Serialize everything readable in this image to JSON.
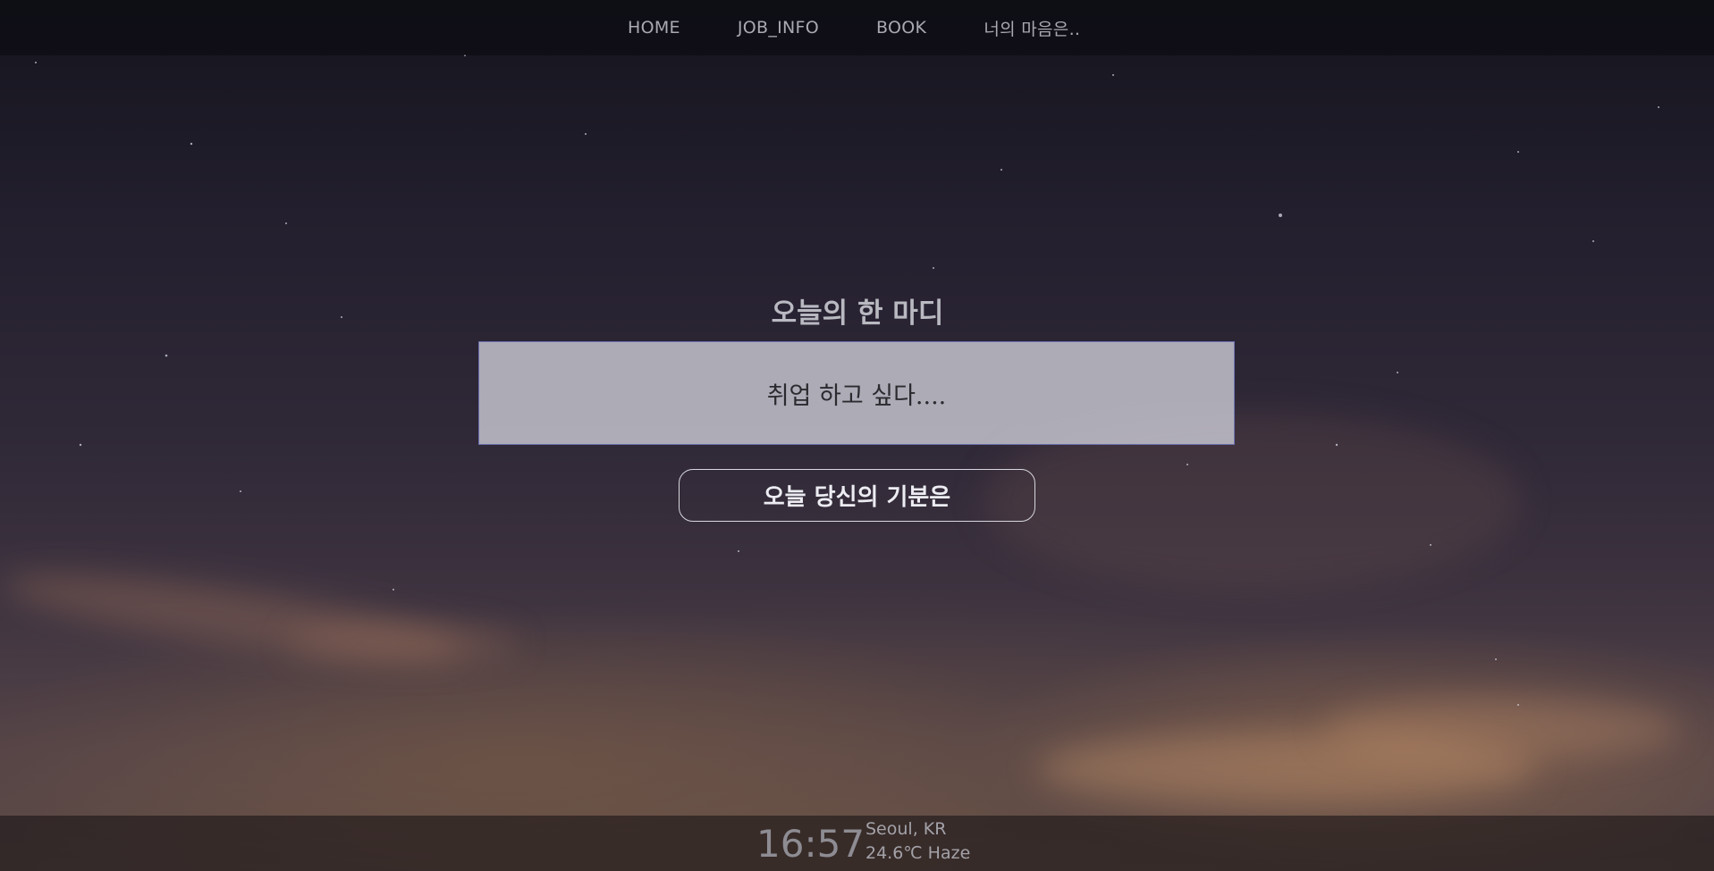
{
  "nav": {
    "items": [
      {
        "label": "HOME"
      },
      {
        "label": "JOB_INFO"
      },
      {
        "label": "BOOK"
      },
      {
        "label": "너의 마음은.."
      }
    ]
  },
  "main": {
    "title": "오늘의 한 마디",
    "quote_value": "취업 하고 싶다....",
    "mood_button_label": "오늘 당신의 기분은"
  },
  "footer": {
    "time": "16:57",
    "location": "Seoul, KR",
    "weather": "24.6℃ Haze"
  },
  "colors": {
    "nav_text": "#a9a9b2",
    "box_border": "#6a6fae",
    "sky_top": "#15141d",
    "sky_bottom": "#5c4a46"
  }
}
